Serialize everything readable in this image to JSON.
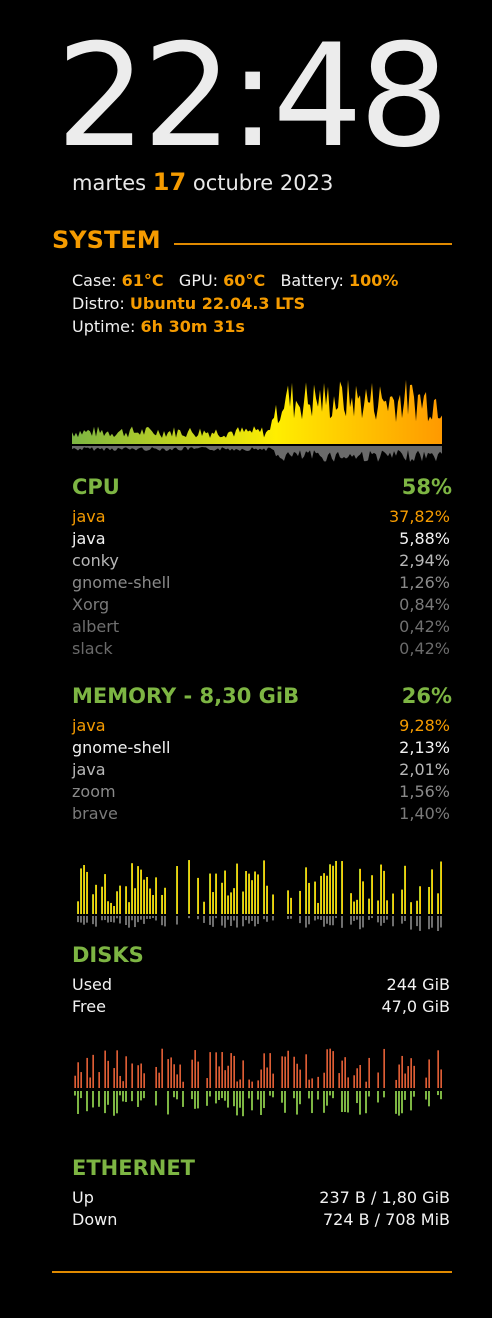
{
  "clock": {
    "time": "22:48"
  },
  "date": {
    "weekday": "martes",
    "day": "17",
    "month_year": "octubre 2023"
  },
  "system": {
    "title": "SYSTEM",
    "case_label": "Case:",
    "case_value": "61°C",
    "gpu_label": "GPU:",
    "gpu_value": "60°C",
    "battery_label": "Battery:",
    "battery_value": "100%",
    "distro_label": "Distro:",
    "distro_value": "Ubuntu 22.04.3 LTS",
    "uptime_label": "Uptime:",
    "uptime_value": "6h 30m 31s"
  },
  "cpu": {
    "title": "CPU",
    "percent": "58%",
    "processes": [
      {
        "name": "java",
        "value": "37,82%"
      },
      {
        "name": "java",
        "value": "5,88%"
      },
      {
        "name": "conky",
        "value": "2,94%"
      },
      {
        "name": "gnome-shell",
        "value": "1,26%"
      },
      {
        "name": "Xorg",
        "value": "0,84%"
      },
      {
        "name": "albert",
        "value": "0,42%"
      },
      {
        "name": "slack",
        "value": "0,42%"
      }
    ]
  },
  "memory": {
    "title": "MEMORY - 8,30 GiB",
    "percent": "26%",
    "processes": [
      {
        "name": "java",
        "value": "9,28%"
      },
      {
        "name": "gnome-shell",
        "value": "2,13%"
      },
      {
        "name": "java",
        "value": "2,01%"
      },
      {
        "name": "zoom",
        "value": "1,56%"
      },
      {
        "name": "brave",
        "value": "1,40%"
      }
    ]
  },
  "disks": {
    "title": "DISKS",
    "used_label": "Used",
    "used_value": "244 GiB",
    "free_label": "Free",
    "free_value": "47,0 GiB"
  },
  "ethernet": {
    "title": "ETHERNET",
    "up_label": "Up",
    "up_value": "237 B / 1,80 GiB",
    "down_label": "Down",
    "down_value": "724 B / 708 MiB"
  },
  "colors": {
    "accent": "#f59b00",
    "green": "#7db543",
    "graph_low": "#7db543",
    "graph_mid": "#ffee00",
    "graph_high": "#ff9900",
    "disk_read": "#e8663a",
    "disk_write": "#7db543"
  }
}
